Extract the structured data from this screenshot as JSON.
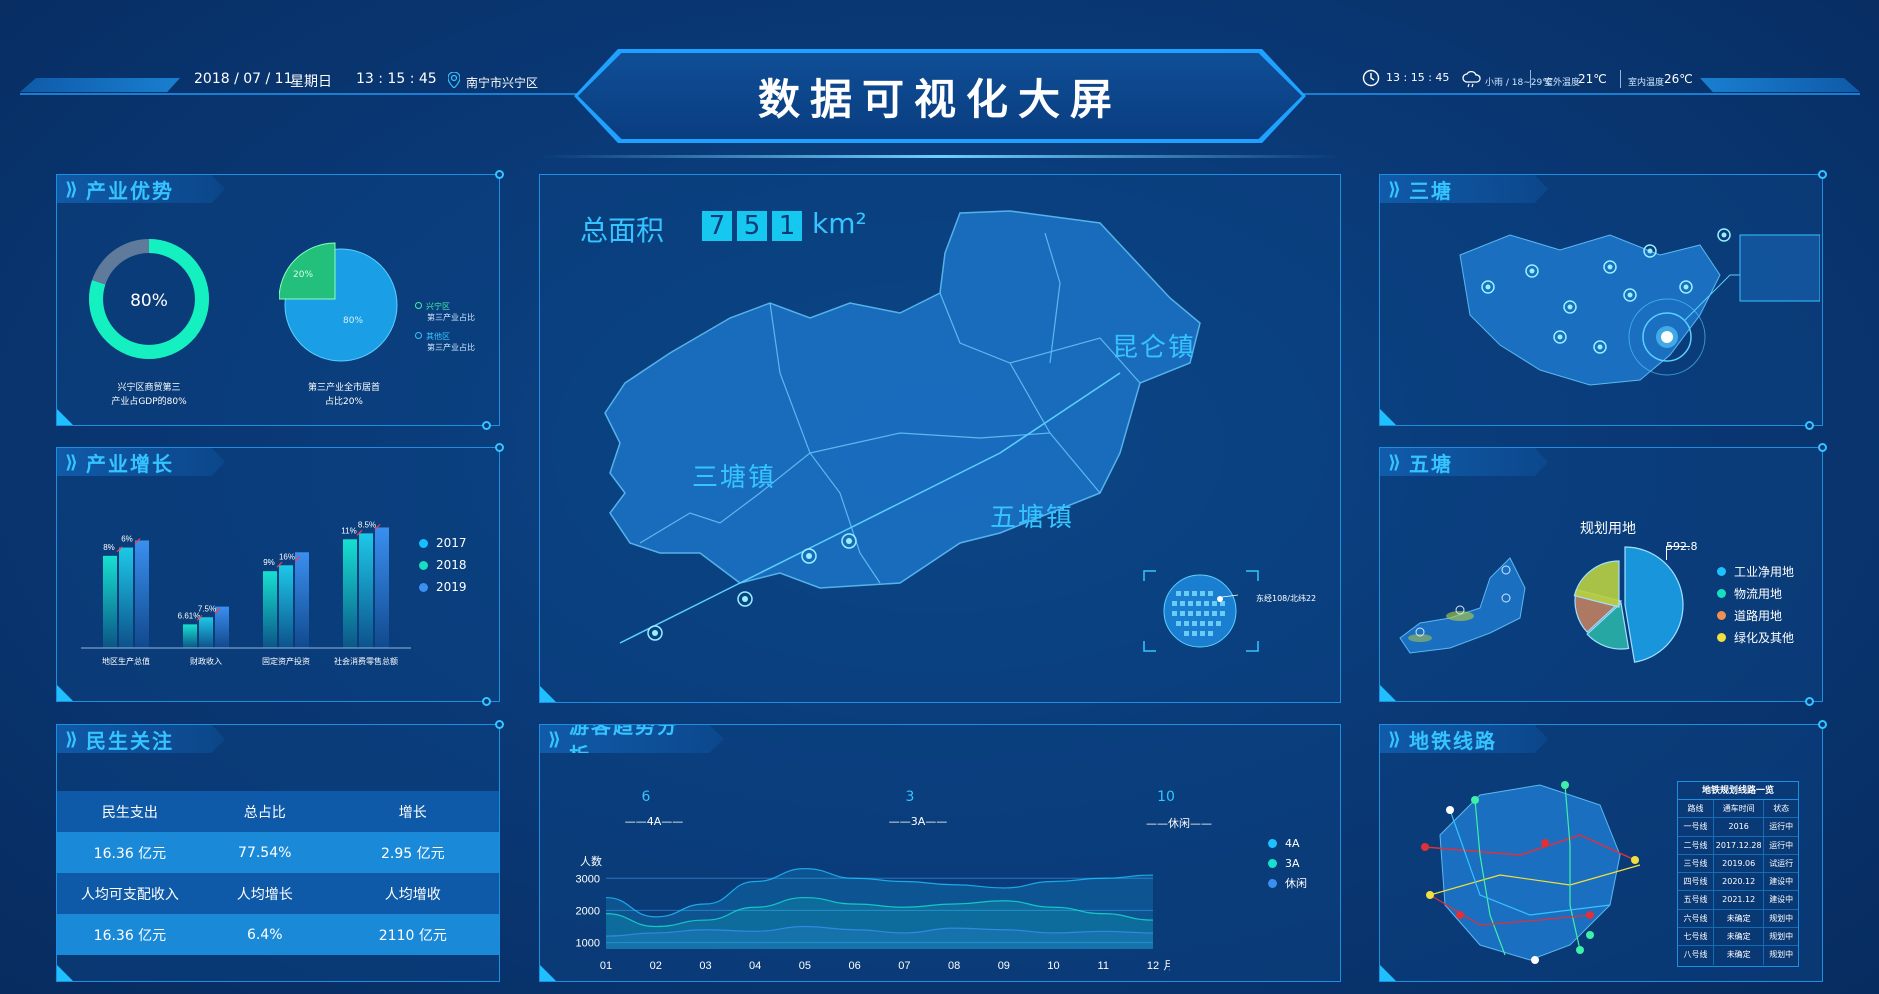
{
  "header": {
    "date": "2018 / 07 / 11",
    "weekday": "星期日",
    "time": "13 : 15 : 45",
    "location": "南宁市兴宁区",
    "title": "数据可视化大屏",
    "right_time": "13 : 15 : 45",
    "weather_small": "小雨 / 18~29℃",
    "temp1_label": "室外温度",
    "temp1": "21℃",
    "temp2_label": "室内温度",
    "temp2": "26℃"
  },
  "industry_advantage": {
    "title": "产业优势",
    "ring_value": "80%",
    "ring_caption_1": "兴宁区商贸第三",
    "ring_caption_2": "产业占GDP的80%",
    "pie_small": "20%",
    "pie_large": "80%",
    "pie_caption_1": "第三产业全市居首",
    "pie_caption_2": "占比20%",
    "legend": [
      {
        "name": "兴宁区",
        "sub": "第三产业占比",
        "color": "#3ef0a8"
      },
      {
        "name": "其他区",
        "sub": "第三产业占比",
        "color": "#35c4ff"
      }
    ],
    "colors": {
      "ring": "#14f0c0",
      "ring_bg": "#5f7a9a",
      "pie_main": "#1a9ee6",
      "pie_slice": "#22c07a"
    }
  },
  "industry_growth": {
    "title": "产业增长",
    "chart_data": {
      "type": "bar",
      "categories": [
        "地区生产总值",
        "财政收入",
        "固定资产投资",
        "社会消费零售总额"
      ],
      "series": [
        {
          "name": "2017",
          "values": [
            78,
            20,
            65,
            92
          ],
          "color": "#16e0d0"
        },
        {
          "name": "2018",
          "values": [
            85,
            26,
            70,
            97
          ],
          "color": "#1dc8e8"
        },
        {
          "name": "2019",
          "values": [
            91,
            35,
            81,
            102
          ],
          "color": "#3a8ff0"
        }
      ],
      "annotations": [
        "8%",
        "6%",
        "6.61%",
        "7.5%",
        "9%",
        "16%",
        "11%",
        "8.5%"
      ]
    }
  },
  "livelihood": {
    "title": "民生关注",
    "rows": [
      [
        "民生支出",
        "总占比",
        "增长"
      ],
      [
        "16.36 亿元",
        "77.54%",
        "2.95 亿元"
      ],
      [
        "人均可支配收入",
        "人均增长",
        "人均增收"
      ],
      [
        "16.36 亿元",
        "6.4%",
        "2110 亿元"
      ]
    ]
  },
  "map": {
    "area_label": "总面积",
    "area_digits": [
      "7",
      "5",
      "1"
    ],
    "area_unit": "km²",
    "towns": [
      "昆仑镇",
      "三塘镇",
      "五塘镇"
    ],
    "coord": "东经108/北纬22"
  },
  "tourist": {
    "title": "游客趋势分析",
    "stats": [
      {
        "value": "6",
        "label": "4A"
      },
      {
        "value": "3",
        "label": "3A"
      },
      {
        "value": "10",
        "label": "休闲"
      }
    ],
    "chart_data": {
      "type": "area",
      "x": [
        "01",
        "02",
        "03",
        "04",
        "05",
        "06",
        "07",
        "08",
        "09",
        "10",
        "11",
        "12"
      ],
      "xunit": "月",
      "ylabel": "人数",
      "yticks": [
        1000,
        2000,
        3000
      ],
      "series": [
        {
          "name": "4A",
          "values": [
            2400,
            1800,
            2200,
            2900,
            3300,
            3000,
            2900,
            2800,
            2700,
            2900,
            3000,
            3100
          ],
          "color": "#1ec0ff"
        },
        {
          "name": "3A",
          "values": [
            1900,
            1500,
            1700,
            2100,
            2400,
            2200,
            2100,
            2200,
            2300,
            2100,
            1900,
            1700
          ],
          "color": "#16e0d0"
        },
        {
          "name": "休闲",
          "values": [
            1200,
            1300,
            1400,
            1350,
            1500,
            1400,
            1300,
            1450,
            1400,
            1300,
            1350,
            1300
          ],
          "color": "#3a8ff0"
        }
      ]
    }
  },
  "santang": {
    "title": "三塘"
  },
  "wutang": {
    "title": "五塘",
    "pie_title": "规划用地",
    "pie_value_label": "592.8",
    "chart_data": {
      "type": "pie",
      "categories": [
        "工业净用地",
        "物流用地",
        "道路用地",
        "绿化及其他"
      ],
      "values": [
        45,
        15,
        15,
        20
      ],
      "colors": [
        "#1a9ee6",
        "#2ab3a8",
        "#c08060",
        "#b8d040"
      ]
    }
  },
  "metro": {
    "title": "地铁线路",
    "table_title": "地铁规划线路一览",
    "headers": [
      "路线",
      "通车时间",
      "状态"
    ],
    "rows": [
      [
        "一号线",
        "2016",
        "运行中"
      ],
      [
        "二号线",
        "2017.12.28",
        "运行中"
      ],
      [
        "三号线",
        "2019.06",
        "试运行"
      ],
      [
        "四号线",
        "2020.12",
        "建设中"
      ],
      [
        "五号线",
        "2021.12",
        "建设中"
      ],
      [
        "六号线",
        "未确定",
        "规划中"
      ],
      [
        "七号线",
        "未确定",
        "规划中"
      ],
      [
        "八号线",
        "未确定",
        "规划中"
      ]
    ]
  }
}
